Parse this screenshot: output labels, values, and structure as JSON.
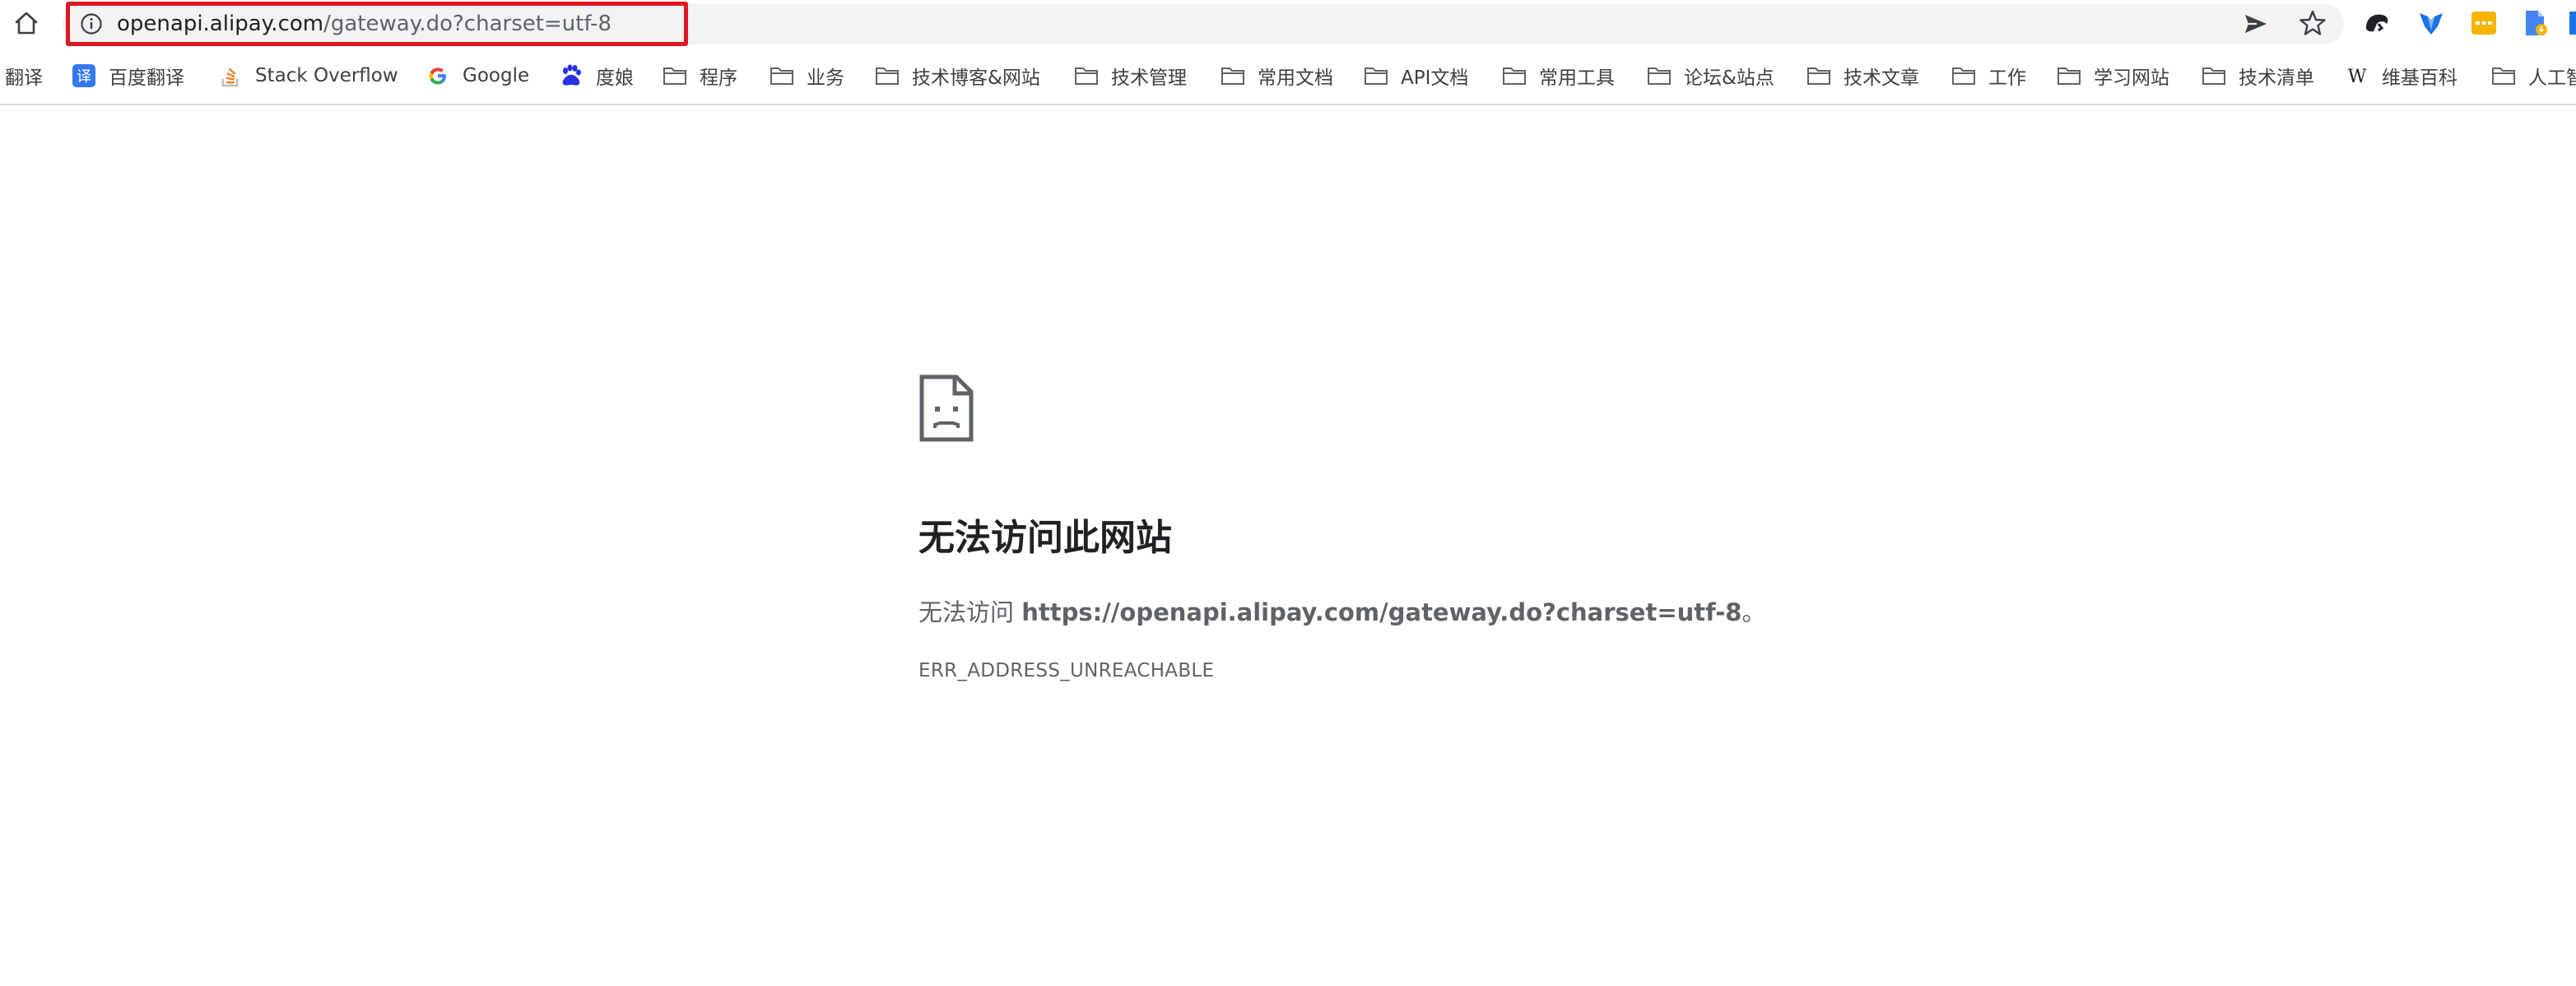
{
  "toolbar": {
    "url_host": "openapi.alipay.com",
    "url_path": "/gateway.do?charset=utf-8"
  },
  "icons": {
    "home": "home-icon",
    "info": "info-icon",
    "send": "send-icon",
    "star": "star-icon",
    "extensions": [
      "ext-shield-icon",
      "ext-fox-icon",
      "ext-yellow-icon",
      "ext-doc-icon",
      "ext-blue-icon"
    ],
    "folder": "folder-icon",
    "error": "sad-document-icon"
  },
  "bookmarks": [
    {
      "label": "翻译",
      "icon": "none"
    },
    {
      "label": "百度翻译",
      "icon": "translate-icon"
    },
    {
      "label": "Stack Overflow",
      "icon": "stackoverflow-icon"
    },
    {
      "label": "Google",
      "icon": "google-icon"
    },
    {
      "label": "度娘",
      "icon": "baidu-icon"
    },
    {
      "label": "程序",
      "icon": "folder-icon"
    },
    {
      "label": "业务",
      "icon": "folder-icon"
    },
    {
      "label": "技术博客&网站",
      "icon": "folder-icon"
    },
    {
      "label": "技术管理",
      "icon": "folder-icon"
    },
    {
      "label": "常用文档",
      "icon": "folder-icon"
    },
    {
      "label": "API文档",
      "icon": "folder-icon"
    },
    {
      "label": "常用工具",
      "icon": "folder-icon"
    },
    {
      "label": "论坛&站点",
      "icon": "folder-icon"
    },
    {
      "label": "技术文章",
      "icon": "folder-icon"
    },
    {
      "label": "工作",
      "icon": "folder-icon"
    },
    {
      "label": "学习网站",
      "icon": "folder-icon"
    },
    {
      "label": "技术清单",
      "icon": "folder-icon"
    },
    {
      "label": "维基百科",
      "icon": "wikipedia-icon"
    },
    {
      "label": "人工智",
      "icon": "folder-icon"
    }
  ],
  "error": {
    "title": "无法访问此网站",
    "msg_prefix": "无法访问 ",
    "msg_url": "https://openapi.alipay.com/gateway.do?charset=utf-8",
    "msg_suffix": "。",
    "code": "ERR_ADDRESS_UNREACHABLE"
  },
  "colors": {
    "highlight_border": "#e0161f",
    "omnibox_bg": "#f1f3f4",
    "text_primary": "#202124",
    "text_secondary": "#5f6368"
  }
}
